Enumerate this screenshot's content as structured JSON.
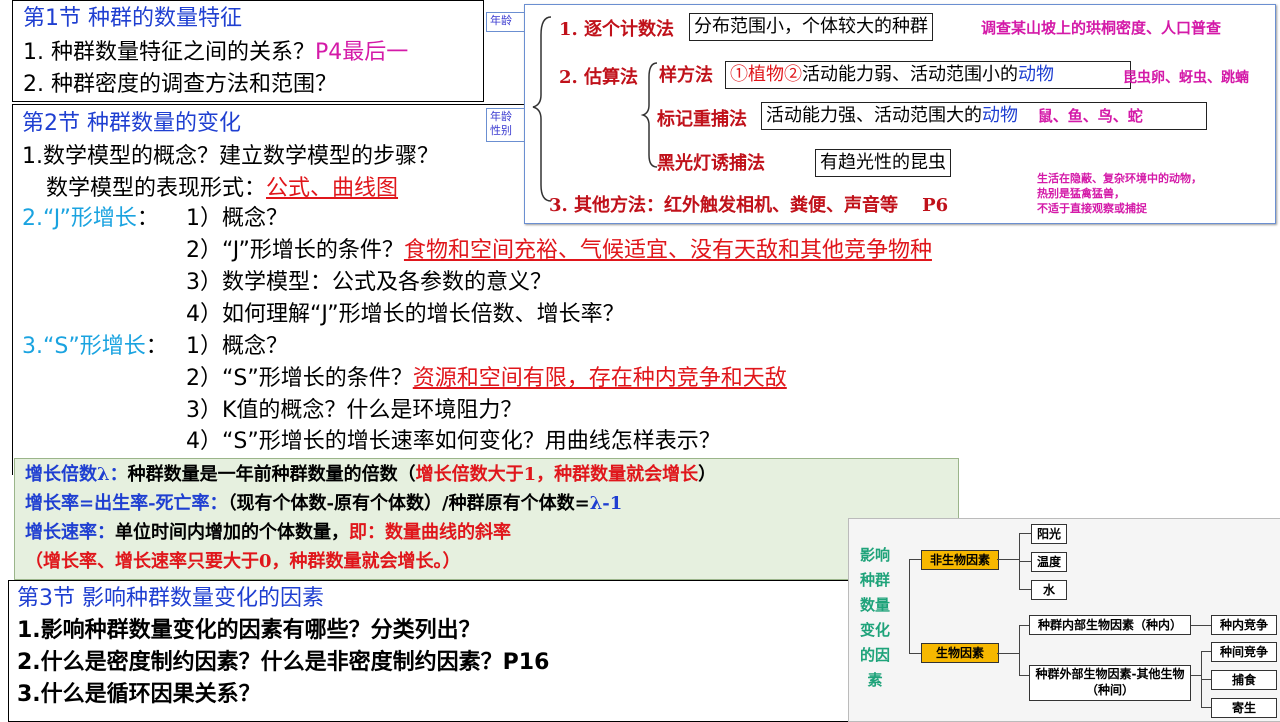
{
  "section1": {
    "title": "第1节 种群的数量特征",
    "q1": "1. 种群数量特征之间的关系？",
    "q1_note": "P4最后一",
    "q2": "2. 种群密度的调查方法和范围？"
  },
  "section2": {
    "title": "第2节 种群数量的变化",
    "item1": "1.数学模型的概念？建立数学模型的步骤？",
    "item1b_label": "数学模型的表现形式：",
    "item1b_answer": "公式、曲线图",
    "j_title": "2.“J”形增长",
    "j_colon": "：",
    "j1": "1）概念？",
    "j2_q": "2）“J”形增长的条件？",
    "j2_a": "食物和空间充裕、气候适宜、没有天敌和其他竞争物种",
    "j3": "3）数学模型：公式及各参数的意义？",
    "j4": "4）如何理解“J”形增长的增长倍数、增长率？",
    "s_title": "3.“S”形增长",
    "s_colon": "：",
    "s1": "1）概念？",
    "s2_q": "2）“S”形增长的条件？",
    "s2_a": "资源和空间有限，存在种内竞争和天敌",
    "s3": "3）K值的概念？什么是环境阻力？",
    "s4": "4）“S”形增长的增长速率如何变化？用曲线怎样表示？"
  },
  "note": {
    "l1_label": "增长倍数λ：",
    "l1_text": "种群数量是一年前种群数量的倍数（",
    "l1_red": "增长倍数大于1，种群数量就会增长",
    "l1_end": "）",
    "l2_label": "增长率=出生率-死亡率：",
    "l2_text": "（现有个体数-原有个体数）/种群原有个体数=",
    "l2_blue": "λ-1",
    "l3_label": "增长速率：",
    "l3_text": "单位时间内增加的个体数量，",
    "l3_red": "即：数量曲线的斜率",
    "l4_red": "（增长率、增长速率只要大于0，种群数量就会增长。）"
  },
  "section3": {
    "title": "第3节 影响种群数量变化的因素",
    "q1": "1.影响种群数量变化的因素有哪些？分类列出？",
    "q2": "2.什么是密度制约因素？什么是非密度制约因素？P16",
    "q3": "3.什么是循环因果关系？"
  },
  "cards": {
    "age": "年龄",
    "age_sex_1": "年龄",
    "age_sex_2": "性别"
  },
  "survey": {
    "m1_label": "1. 逐个计数法",
    "m1_box": "分布范围小，个体较大的种群",
    "m1_example": "调查某山坡上的珙桐密度、人口普查",
    "m2_label": "2. 估算法",
    "quadrat_label": "样方法",
    "quadrat_box_a": "①植物②",
    "quadrat_box_b": "活动能力弱、活动范围小的",
    "quadrat_box_c": "动物",
    "quadrat_example": "昆虫卵、蚜虫、跳蝻",
    "mark_label": "标记重捕法",
    "mark_box_a": "活动能力强、活动范围大的",
    "mark_box_b": "动物",
    "mark_example": "鼠、鱼、鸟、蛇",
    "light_label": "黑光灯诱捕法",
    "light_box": "有趋光性的昆虫",
    "light_note_1": "生活在隐蔽、复杂环境中的动物，",
    "light_note_2": "热别是猛禽猛兽，",
    "light_note_3": "不适于直接观察或捕捉",
    "m3_label": "3. 其他方法：红外触发相机、粪便、声音等",
    "m3_page": "P6"
  },
  "factors": {
    "side_title": [
      "影响",
      "种群",
      "数量",
      "变化",
      "的因",
      "素"
    ],
    "abiotic": "非生物因素",
    "sun": "阳光",
    "temp": "温度",
    "water": "水",
    "biotic": "生物因素",
    "intra": "种群内部生物因素（种内）",
    "intra_comp": "种内竞争",
    "inter": "种群外部生物因素-其他生物（种间）",
    "inter_comp": "种间竞争",
    "predation": "捕食",
    "parasitism": "寄生"
  }
}
